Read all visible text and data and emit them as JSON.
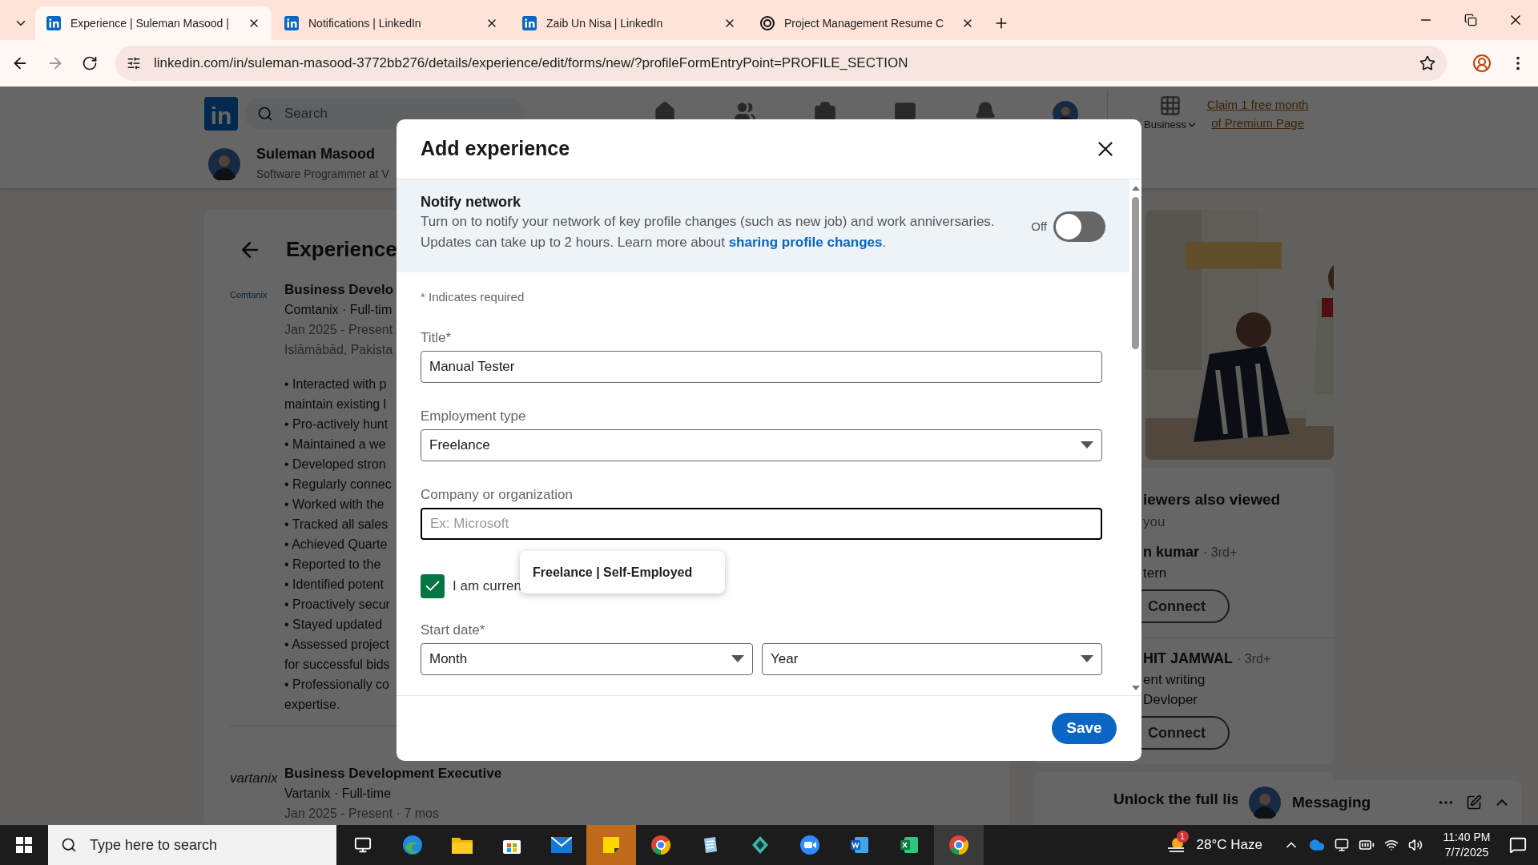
{
  "browser": {
    "tabs": [
      {
        "title": "Experience | Suleman Masood |",
        "selected": true
      },
      {
        "title": "Notifications | LinkedIn",
        "selected": false
      },
      {
        "title": "Zaib Un Nisa | LinkedIn",
        "selected": false
      },
      {
        "title": "Project Management Resume C",
        "selected": false
      }
    ],
    "url": "linkedin.com/in/suleman-masood-3772bb276/details/experience/edit/forms/new/?profileFormEntryPoint=PROFILE_SECTION"
  },
  "header": {
    "logo_text": "in",
    "search_placeholder": "Search",
    "business_label": "Business",
    "premium_link": [
      "Claim 1 free month",
      "of Premium Page"
    ]
  },
  "profile_strip": {
    "name": "Suleman Masood",
    "headline": "Software Programmer at V"
  },
  "experience": {
    "title": "Experience",
    "entries": [
      {
        "logo": "Comtanix",
        "role": "Business Develo",
        "company": "Comtanix · Full-tim",
        "dates": "Jan 2025 - Present",
        "location": "Islāmābād, Pakista",
        "description": [
          "• Interacted with p",
          "maintain existing l",
          "• Pro-actively hunt",
          "• Maintained a we",
          "• Developed stron",
          "• Regularly connec",
          "• Worked with the",
          "• Tracked all sales",
          "• Achieved Quarte",
          "• Reported to the",
          "• Identified potent",
          "• Proactively secur",
          "• Stayed updated",
          "• Assessed project",
          "for successful bids",
          "• Professionally co",
          "expertise."
        ]
      },
      {
        "logo": "vartanix",
        "role": "Business Development Executive",
        "company": "Vartanix · Full-time",
        "dates": "Jan 2025 - Present · 7 mos"
      }
    ]
  },
  "viewers": {
    "title": "iewers also viewed",
    "subtitle": "you",
    "people": [
      {
        "name": "n kumar",
        "degree": "· 3rd+",
        "headline": [
          "tern"
        ],
        "button": "Connect"
      },
      {
        "name": "HIT JAMWAL",
        "degree": "· 3rd+",
        "headline": [
          "ent writing",
          "Devloper"
        ],
        "button": "Connect"
      }
    ],
    "unlock": "Unlock the full lis"
  },
  "messaging": {
    "title": "Messaging"
  },
  "modal": {
    "title": "Add experience",
    "notify": {
      "heading": "Notify network",
      "text": "Turn on to notify your network of key profile changes (such as new job) and work anniversaries. Updates can take up to 2 hours. Learn more about",
      "link": "sharing profile changes",
      "text_end": ".",
      "toggle_label": "Off",
      "on": false
    },
    "required_note": "* Indicates required",
    "fields": [
      {
        "kind": "input",
        "label": "Title*",
        "value": "Manual Tester",
        "focused": false
      },
      {
        "kind": "select",
        "label": "Employment type",
        "value": "Freelance",
        "focused": false
      },
      {
        "kind": "input",
        "label": "Company or organization",
        "placeholder": "Ex: Microsoft",
        "focused": true
      }
    ],
    "suggestion": "Freelance | Self-Employed",
    "current_checkbox": {
      "label": "I am curren",
      "checked": true
    },
    "start_date": {
      "label": "Start date*",
      "selects": [
        "Month",
        "Year"
      ]
    },
    "save": "Save"
  },
  "taskbar": {
    "search_placeholder": "Type here to search",
    "apps": [
      {
        "kind": "taskview",
        "selected": false
      },
      {
        "kind": "edge",
        "selected": false
      },
      {
        "kind": "explorer",
        "selected": false
      },
      {
        "kind": "store",
        "selected": false
      },
      {
        "kind": "mail",
        "selected": false
      },
      {
        "kind": "sticky",
        "selected": true
      },
      {
        "kind": "chrome",
        "selected": false
      },
      {
        "kind": "notes",
        "selected": false
      },
      {
        "kind": "gem",
        "selected": false
      },
      {
        "kind": "zoom",
        "selected": false
      },
      {
        "kind": "word",
        "selected": false
      },
      {
        "kind": "excel",
        "selected": false
      },
      {
        "kind": "chrome",
        "selected": false
      }
    ],
    "weather": {
      "badge": "1",
      "temp": "28°C",
      "condition": "Haze"
    },
    "time": "11:40 PM",
    "date": "7/7/2025"
  }
}
